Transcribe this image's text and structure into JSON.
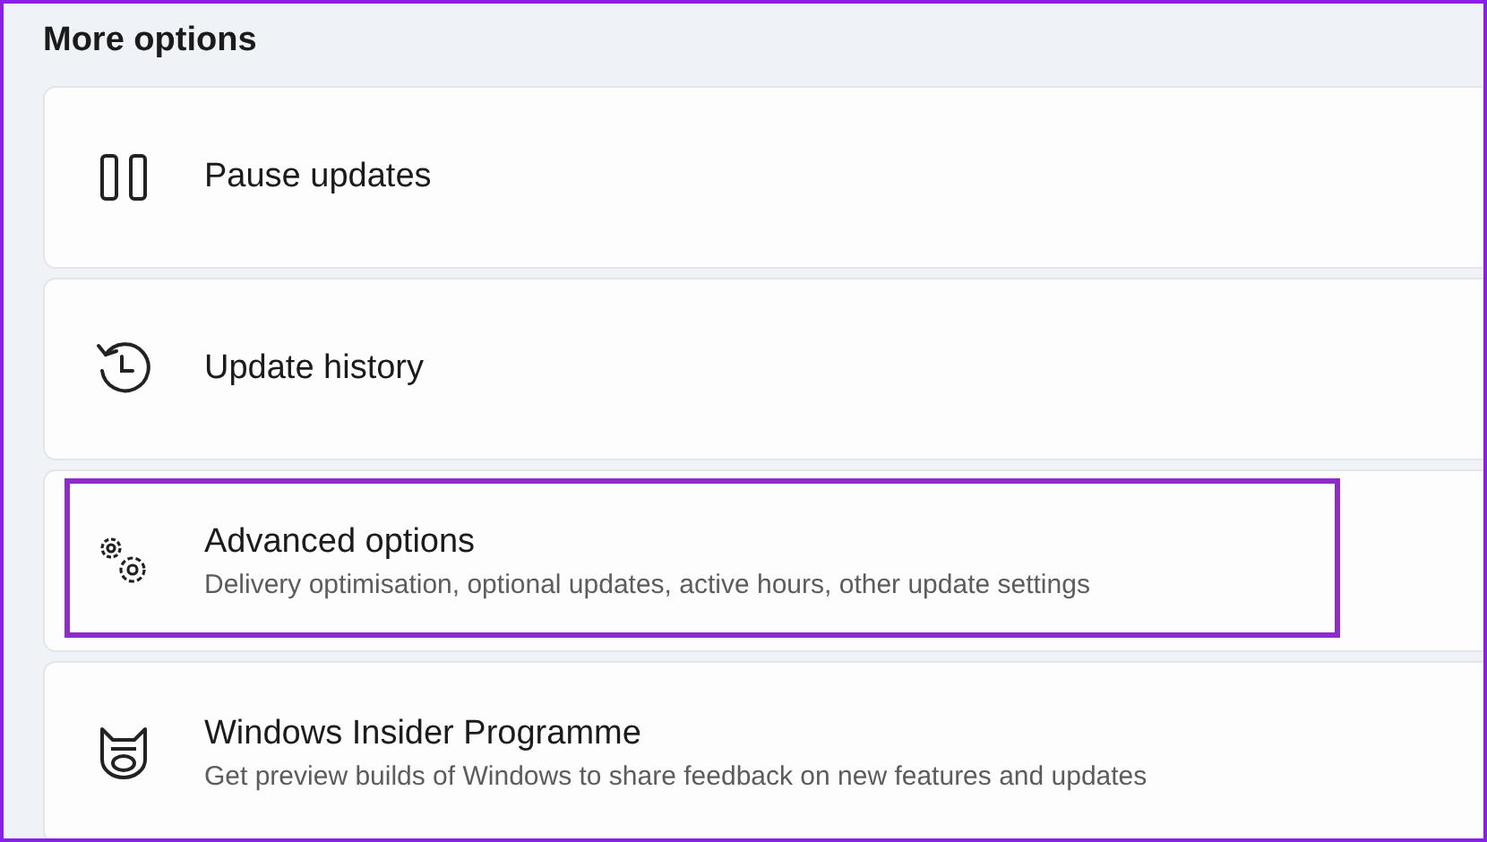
{
  "section": {
    "title": "More options"
  },
  "items": [
    {
      "title": "Pause updates",
      "highlighted": false
    },
    {
      "title": "Update history",
      "highlighted": false
    },
    {
      "title": "Advanced options",
      "description": "Delivery optimisation, optional updates, active hours, other update settings",
      "highlighted": true
    },
    {
      "title": "Windows Insider Programme",
      "description": "Get preview builds of Windows to share feedback on new features and updates",
      "highlighted": false
    }
  ]
}
